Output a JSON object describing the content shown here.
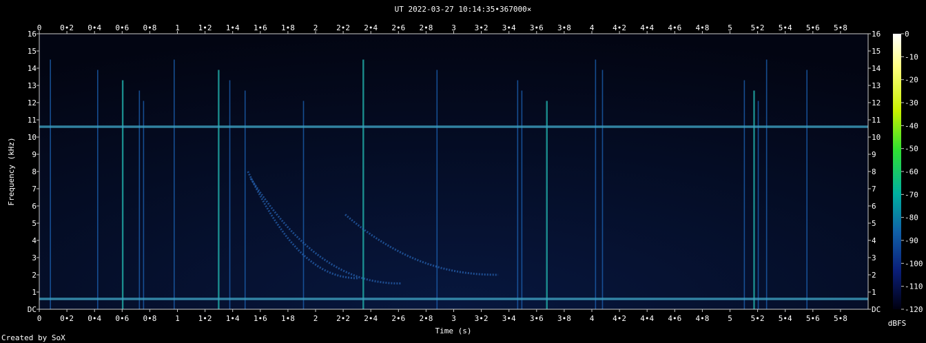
{
  "chart_data": {
    "type": "heatmap",
    "title": "UT 2022-03-27 10:14:35•367000×",
    "xlabel": "Time (s)",
    "ylabel": "Frequency (kHz)",
    "xlim": [
      0,
      5.96
    ],
    "ylim": [
      0,
      16
    ],
    "x_ticks": [
      "0",
      "0•2",
      "0•4",
      "0•6",
      "0•8",
      "1",
      "1•2",
      "1•4",
      "1•6",
      "1•8",
      "2",
      "2•2",
      "2•4",
      "2•6",
      "2•8",
      "3",
      "3•2",
      "3•4",
      "3•6",
      "3•8",
      "4",
      "4•2",
      "4•4",
      "4•6",
      "4•8",
      "5",
      "5•2",
      "5•4",
      "5•6",
      "5•8"
    ],
    "y_ticks": [
      "DC",
      "1",
      "2",
      "3",
      "4",
      "5",
      "6",
      "7",
      "8",
      "9",
      "10",
      "11",
      "12",
      "13",
      "14",
      "15",
      "16"
    ],
    "colorbar": {
      "label": "dBFS",
      "ticks": [
        "0",
        "-10",
        "-20",
        "-30",
        "-40",
        "-50",
        "-60",
        "-70",
        "-80",
        "-90",
        "-100",
        "-110",
        "-120"
      ],
      "range": [
        -120,
        0
      ]
    },
    "features": {
      "horizontal_lines_khz": [
        10.6,
        0.6
      ],
      "vertical_impulses_s": [
        0.08,
        0.42,
        0.6,
        0.72,
        0.75,
        0.97,
        1.29,
        1.37,
        1.48,
        1.9,
        2.33,
        2.86,
        3.44,
        3.47,
        3.65,
        4.0,
        4.05,
        5.07,
        5.14,
        5.17,
        5.23,
        5.52
      ],
      "whistler_curves": [
        {
          "t0": 1.5,
          "f_start_khz": 8.0,
          "f_end_khz": 1.8,
          "t_end": 2.3
        },
        {
          "t0": 1.52,
          "f_start_khz": 7.6,
          "f_end_khz": 1.5,
          "t_end": 2.6
        },
        {
          "t0": 2.2,
          "f_start_khz": 5.5,
          "f_end_khz": 2.0,
          "t_end": 3.3
        }
      ]
    }
  },
  "footer": {
    "credit": "Created by SoX"
  }
}
